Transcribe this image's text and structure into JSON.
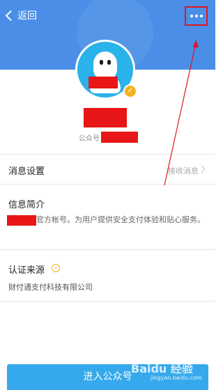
{
  "header": {
    "back_label": "返回",
    "back_icon": "chevron-left-icon",
    "more_icon": "more-dots-icon",
    "color": "#4a8ee8"
  },
  "profile": {
    "avatar_icon": "qq-penguin-icon",
    "verified_icon": "verified-check-icon",
    "account_label": "公众号"
  },
  "settings": {
    "message_settings_label": "消息设置",
    "message_settings_value": "接收消息"
  },
  "intro": {
    "title": "信息简介",
    "text": "官方帐号。为用户提供安全支付体验和贴心服务。"
  },
  "certification": {
    "title": "认证来源",
    "organization": "财付通支付科技有限公司"
  },
  "footer": {
    "enter_button_label": "进入公众号",
    "watermark_text": "Baidu 经验",
    "watermark_url": "jingyan.baidu.com"
  },
  "colors": {
    "accent": "#35a9ec",
    "redaction": "#e81616",
    "highlight_box": "#e0151d"
  }
}
